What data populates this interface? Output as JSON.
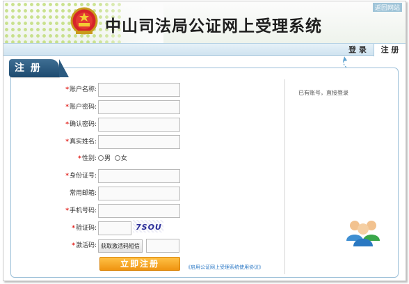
{
  "header": {
    "site_title": "中山司法局公证网上受理系统",
    "home_link": "返回网站"
  },
  "nav": {
    "tabs": [
      {
        "label": "登 录",
        "active": false
      },
      {
        "label": "注 册",
        "active": true
      }
    ]
  },
  "panel": {
    "title": "注 册"
  },
  "form": {
    "required_mark": "*",
    "fields": [
      {
        "label": "账户名称:",
        "required": true,
        "value": ""
      },
      {
        "label": "账户密码:",
        "required": true,
        "value": ""
      },
      {
        "label": "确认密码:",
        "required": true,
        "value": ""
      },
      {
        "label": "真实姓名:",
        "required": true,
        "value": ""
      },
      {
        "label": "身份证号:",
        "required": true,
        "value": ""
      },
      {
        "label": "常用邮箱:",
        "required": false,
        "value": ""
      },
      {
        "label": "手机号码:",
        "required": true,
        "value": ""
      },
      {
        "label": "验证码:",
        "required": true,
        "value": ""
      },
      {
        "label": "激活码:",
        "required": true,
        "value": ""
      }
    ],
    "gender": {
      "label": "性别:",
      "options": [
        "男",
        "女"
      ]
    },
    "captcha_text": "7SOU",
    "sms_button": "获取激活码短信",
    "submit_button": "立即注册",
    "agreement_link": "《启用公证网上受理系统使用协议》"
  },
  "side": {
    "login_hint": "已有账号，直接登录"
  },
  "colors": {
    "accent_blue": "#1d4a6f",
    "required_red": "#e2211c",
    "submit_orange": "#ef9410",
    "link_blue": "#2b78c5"
  },
  "icons": [
    "national-emblem-icon",
    "users-group-icon"
  ]
}
